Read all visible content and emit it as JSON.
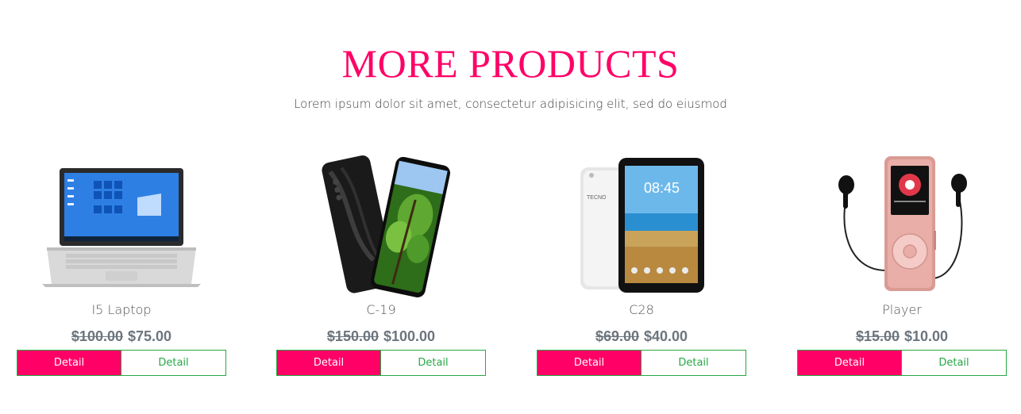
{
  "section": {
    "title": "MORE PRODUCTS",
    "subtitle": "Lorem ipsum dolor sit amet, consectetur adipisicing elit, sed do eiusmod"
  },
  "products": [
    {
      "name": "I5 Laptop",
      "old_price": "$100.00",
      "price": "$75.00",
      "primary_label": "Detail",
      "secondary_label": "Detail",
      "icon": "laptop-icon"
    },
    {
      "name": "C-19",
      "old_price": "$150.00",
      "price": "$100.00",
      "primary_label": "Detail",
      "secondary_label": "Detail",
      "icon": "phone-icon"
    },
    {
      "name": "C28",
      "old_price": "$69.00",
      "price": "$40.00",
      "primary_label": "Detail",
      "secondary_label": "Detail",
      "icon": "tablet-icon",
      "brand": "TECNO",
      "clock": "08:45"
    },
    {
      "name": "Player",
      "old_price": "$15.00",
      "price": "$10.00",
      "primary_label": "Detail",
      "secondary_label": "Detail",
      "icon": "music-player-icon"
    }
  ],
  "colors": {
    "accent": "#ff0066",
    "outline": "#28a745",
    "price": "#6c757d"
  }
}
